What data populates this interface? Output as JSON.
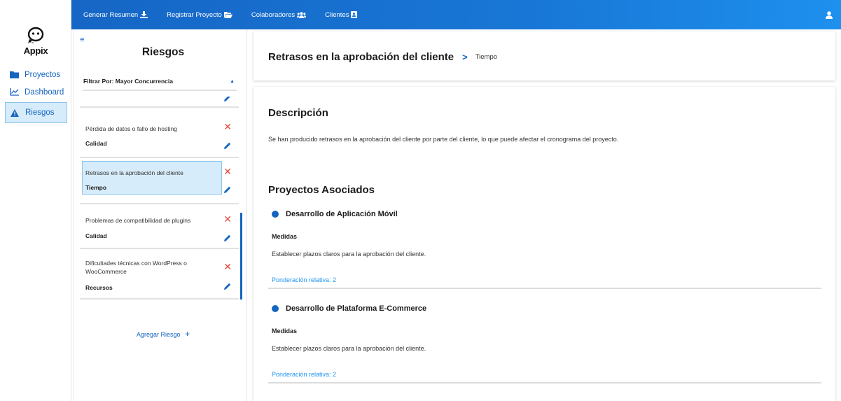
{
  "app": {
    "logo_text": "Appix",
    "brand_color": "#1565c0",
    "danger_color": "#e84a3d"
  },
  "sidebar": {
    "items": [
      {
        "label": "Proyectos",
        "icon": "folder-icon"
      },
      {
        "label": "Dashboard",
        "icon": "line-chart-icon"
      },
      {
        "label": "Riesgos",
        "icon": "warning-icon",
        "active": true
      }
    ]
  },
  "topbar": {
    "items": [
      {
        "label": "Generar Resumen",
        "icon": "download-icon"
      },
      {
        "label": "Registrar Proyecto",
        "icon": "folder-open-icon"
      },
      {
        "label": "Colaboradores",
        "icon": "users-icon"
      },
      {
        "label": "Clientes",
        "icon": "address-book-icon"
      }
    ],
    "user_icon": "user-icon"
  },
  "risks_panel": {
    "title": "Riesgos",
    "filter_label": "Filtrar Por: Mayor Concurrencia",
    "items": [
      {
        "title": "",
        "category": ""
      },
      {
        "title": "Pérdida de datos o fallo de hosting",
        "category": "Calidad"
      },
      {
        "title": "Retrasos en la aprobación del cliente",
        "category": "Tiempo",
        "selected": true
      },
      {
        "title": "Problemas de compatibilidad de plugins",
        "category": "Calidad"
      },
      {
        "title": "Dificultades técnicas con WordPress o WooCommerce",
        "category": "Recursos"
      }
    ],
    "add_label": "Agregar Riesgo",
    "add_symbol": "+"
  },
  "detail": {
    "title": "Retrasos en la aprobación del cliente",
    "breadcrumb_separator": ">",
    "category": "Tiempo",
    "description_heading": "Descripción",
    "description": "Se han producido retrasos en la aprobación del cliente por parte del cliente, lo que puede afectar el cronograma del proyecto.",
    "projects_heading": "Proyectos Asociados",
    "projects": [
      {
        "name": "Desarrollo de Aplicación Móvil",
        "measures_label": "Medidas",
        "measures": "Establecer plazos claros para la aprobación del cliente.",
        "weight": "Ponderación relativa: 2"
      },
      {
        "name": "Desarrollo de Plataforma E-Commerce",
        "measures_label": "Medidas",
        "measures": "Establecer plazos claros para la aprobación del cliente.",
        "weight": "Ponderación relativa: 2"
      }
    ]
  }
}
